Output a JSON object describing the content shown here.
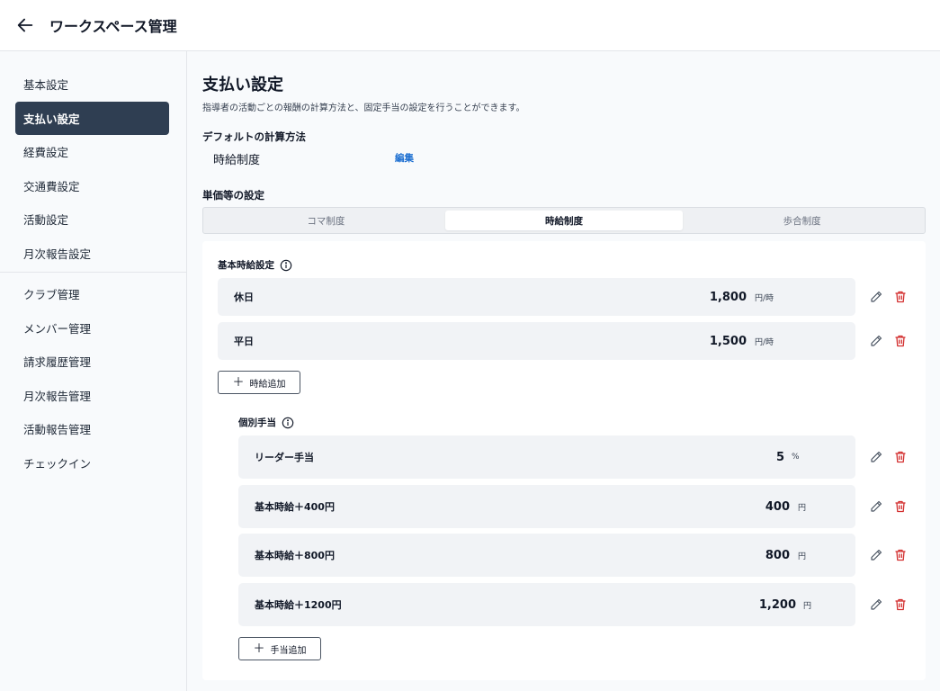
{
  "header": {
    "title": "ワークスペース管理"
  },
  "sidebar": {
    "group1": [
      {
        "label": "基本設定"
      },
      {
        "label": "支払い設定",
        "active": true
      },
      {
        "label": "経費設定"
      },
      {
        "label": "交通費設定"
      },
      {
        "label": "活動設定"
      },
      {
        "label": "月次報告設定"
      }
    ],
    "group2": [
      {
        "label": "クラブ管理"
      },
      {
        "label": "メンバー管理"
      },
      {
        "label": "請求履歴管理"
      },
      {
        "label": "月次報告管理"
      },
      {
        "label": "活動報告管理"
      },
      {
        "label": "チェックイン"
      }
    ]
  },
  "main": {
    "title": "支払い設定",
    "description": "指導者の活動ごとの報酬の計算方法と、固定手当の設定を行うことができます。",
    "default_method_heading": "デフォルトの計算方法",
    "default_method_value": "時給制度",
    "edit_label": "編集",
    "unit_settings_heading": "単価等の設定",
    "tabs": [
      {
        "label": "コマ制度"
      },
      {
        "label": "時給制度",
        "active": true
      },
      {
        "label": "歩合制度"
      }
    ],
    "base_hourly": {
      "label": "基本時給設定",
      "rows": [
        {
          "label": "休日",
          "value": "1,800",
          "unit": "円/時"
        },
        {
          "label": "平日",
          "value": "1,500",
          "unit": "円/時"
        }
      ],
      "add_label": "時給追加"
    },
    "allowances": {
      "label": "個別手当",
      "rows": [
        {
          "label": "リーダー手当",
          "value": "5",
          "unit": "%"
        },
        {
          "label": "基本時給＋400円",
          "value": "400",
          "unit": "円"
        },
        {
          "label": "基本時給＋800円",
          "value": "800",
          "unit": "円"
        },
        {
          "label": "基本時給＋1200円",
          "value": "1,200",
          "unit": "円"
        }
      ],
      "add_label": "手当追加"
    }
  },
  "colors": {
    "accent": "#1d6fd1",
    "active_nav": "#2f3e52",
    "delete": "#d32f2f"
  }
}
